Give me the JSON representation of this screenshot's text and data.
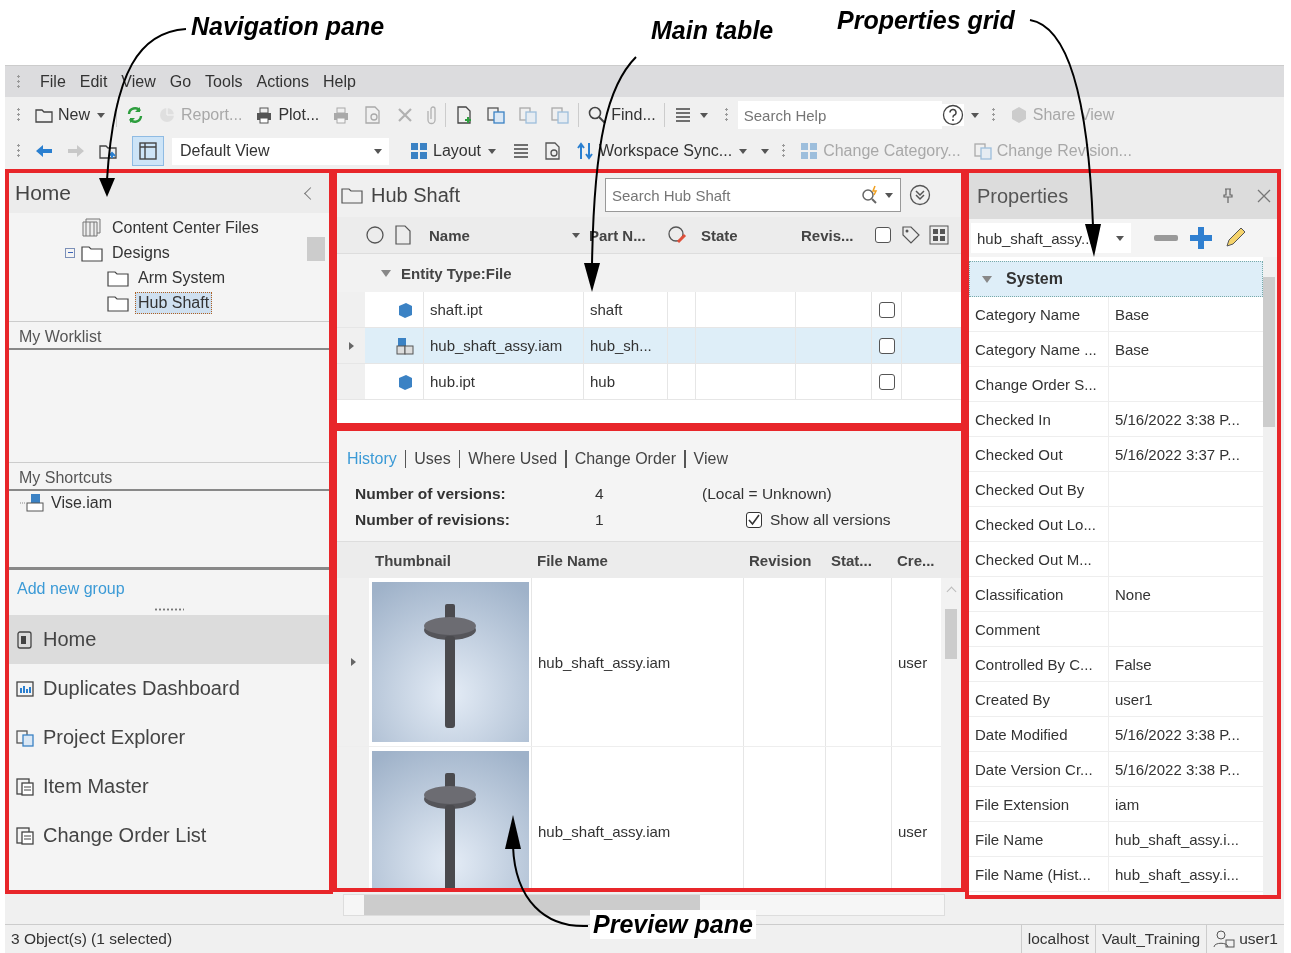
{
  "annotations": [
    {
      "kind": "nav",
      "text": "Navigation pane"
    },
    {
      "kind": "table",
      "text": "Main table"
    },
    {
      "kind": "props",
      "text": "Properties grid"
    },
    {
      "kind": "preview",
      "text": "Preview pane"
    }
  ],
  "menu": [
    "File",
    "Edit",
    "View",
    "Go",
    "Tools",
    "Actions",
    "Help"
  ],
  "toolbar": [
    {
      "kind": "new",
      "label": "New",
      "has_menu": true,
      "disabled": false
    },
    {
      "kind": "refresh",
      "disabled": false
    },
    {
      "kind": "report",
      "label": "Report...",
      "disabled": true
    },
    {
      "kind": "plot",
      "label": "Plot...",
      "disabled": false
    },
    {
      "kind": "print",
      "disabled": true
    },
    {
      "kind": "preview",
      "disabled": true
    },
    {
      "kind": "delete",
      "disabled": true
    },
    {
      "kind": "attach",
      "disabled": true
    },
    {
      "kind": "newfile",
      "disabled": false
    },
    {
      "kind": "copy",
      "disabled": false
    },
    {
      "kind": "move",
      "disabled": true
    },
    {
      "kind": "docs",
      "disabled": true
    },
    {
      "kind": "find",
      "label": "Find...",
      "disabled": false
    },
    {
      "kind": "cart",
      "has_menu": true,
      "disabled": false
    }
  ],
  "search_help": {
    "placeholder": "Search Help"
  },
  "share_view": {
    "label": "Share View",
    "disabled": true
  },
  "nav_buttons": [
    {
      "kind": "back",
      "disabled": false
    },
    {
      "kind": "forward",
      "disabled": true
    },
    {
      "kind": "folderup",
      "disabled": false
    }
  ],
  "pane_toggle": {
    "on": true
  },
  "view_select": {
    "value": "Default View"
  },
  "toolbar2": [
    {
      "kind": "layout",
      "label": "Layout",
      "has_menu": true,
      "disabled": false
    },
    {
      "kind": "list",
      "disabled": false
    },
    {
      "kind": "syncsearch",
      "disabled": false
    },
    {
      "kind": "sync",
      "label": "Workspace Sync...",
      "has_menu": true,
      "disabled": false
    },
    {
      "kind": "category",
      "label": "Change Category...",
      "disabled": true
    },
    {
      "kind": "revision",
      "label": "Change Revision...",
      "disabled": true
    }
  ],
  "nav": {
    "title": "Home",
    "tree": [
      {
        "label": "Content Center Files",
        "kind": "library",
        "selected": false
      },
      {
        "label": "Designs",
        "kind": "folder",
        "expanded": true,
        "selected": false,
        "children": [
          {
            "label": "Arm System",
            "kind": "folder",
            "selected": false
          },
          {
            "label": "Hub Shaft",
            "kind": "folder",
            "selected": true
          }
        ]
      }
    ],
    "worklist": "My Worklist",
    "shortcuts": "My Shortcuts",
    "shortcut_items": [
      {
        "label": "Vise.iam"
      }
    ],
    "add_group": "Add new group",
    "buttons": [
      {
        "kind": "home",
        "label": "Home",
        "selected": true
      },
      {
        "kind": "dashboard",
        "label": "Duplicates Dashboard",
        "selected": false
      },
      {
        "kind": "explorer",
        "label": "Project Explorer",
        "selected": false
      },
      {
        "kind": "items",
        "label": "Item Master",
        "selected": false
      },
      {
        "kind": "orders",
        "label": "Change Order List",
        "selected": false
      }
    ]
  },
  "main_table": {
    "title": "Hub Shaft",
    "search": {
      "placeholder": "Search Hub Shaft"
    },
    "columns": [
      "Name",
      "Part N...",
      "State",
      "Revis..."
    ],
    "group": {
      "label": "Entity Type:File",
      "expanded": true
    },
    "rows": [
      {
        "kind": "part",
        "name": "shaft.ipt",
        "part_number": "shaft",
        "selected": false,
        "checked": false
      },
      {
        "kind": "assembly",
        "name": "hub_shaft_assy.iam",
        "part_number": "hub_sh...",
        "selected": true,
        "checked": false
      },
      {
        "kind": "part",
        "name": "hub.ipt",
        "part_number": "hub",
        "selected": false,
        "checked": false
      }
    ]
  },
  "preview": {
    "tabs": [
      {
        "label": "History",
        "selected": true
      },
      {
        "label": "Uses",
        "selected": false
      },
      {
        "label": "Where Used",
        "selected": false
      },
      {
        "label": "Change Order",
        "selected": false
      },
      {
        "label": "View",
        "selected": false
      }
    ],
    "versions_label": "Number of versions:",
    "versions": "4",
    "local": "(Local = Unknown)",
    "revisions_label": "Number of revisions:",
    "revisions": "1",
    "show_all": {
      "label": "Show all versions",
      "checked": true
    },
    "columns": [
      "Thumbnail",
      "File Name",
      "Revision",
      "Stat...",
      "Cre..."
    ],
    "rows": [
      {
        "file_name": "hub_shaft_assy.iam",
        "created_by": "user",
        "selected": true
      },
      {
        "file_name": "hub_shaft_assy.iam",
        "created_by": "user",
        "selected": false
      }
    ]
  },
  "properties": {
    "title": "Properties",
    "selector": {
      "value": "hub_shaft_assy..."
    },
    "group": {
      "label": "System",
      "expanded": true
    },
    "rows": [
      {
        "name": "Category Name",
        "value": "Base"
      },
      {
        "name": "Category Name ...",
        "value": "Base"
      },
      {
        "name": "Change Order S..."
      },
      {
        "name": "Checked In",
        "value": "5/16/2022 3:38 P..."
      },
      {
        "name": "Checked Out",
        "value": "5/16/2022 3:37 P..."
      },
      {
        "name": "Checked Out By"
      },
      {
        "name": "Checked Out Lo..."
      },
      {
        "name": "Checked Out M..."
      },
      {
        "name": "Classification",
        "value": "None"
      },
      {
        "name": "Comment"
      },
      {
        "name": "Controlled By C...",
        "value": "False"
      },
      {
        "name": "Created By",
        "value": "user1"
      },
      {
        "name": "Date Modified",
        "value": "5/16/2022 3:38 P..."
      },
      {
        "name": "Date Version Cr...",
        "value": "5/16/2022 3:38 P..."
      },
      {
        "name": "File Extension",
        "value": "iam"
      },
      {
        "name": "File Name",
        "value": "hub_shaft_assy.i..."
      },
      {
        "name": "File Name (Hist...",
        "value": "hub_shaft_assy.i..."
      }
    ]
  },
  "status_bar": {
    "text": "3 Object(s) (1 selected)",
    "server": "localhost",
    "vault": "Vault_Training",
    "user": "user1"
  }
}
